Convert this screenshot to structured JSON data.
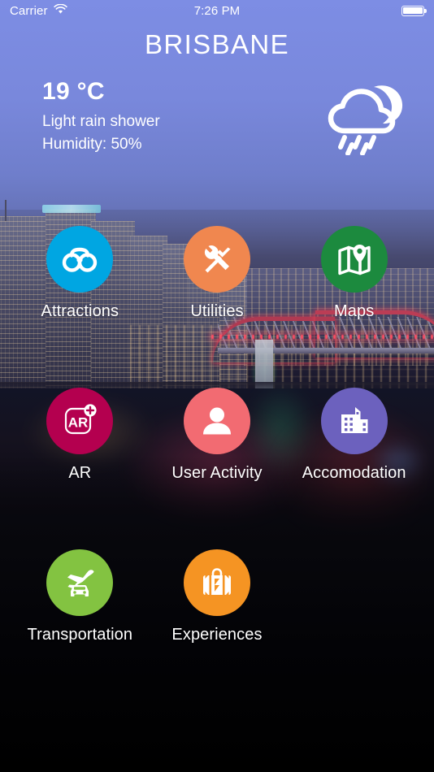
{
  "status_bar": {
    "carrier": "Carrier",
    "wifi_icon": "wifi-icon",
    "time": "7:26 PM",
    "battery_icon": "battery-full-icon"
  },
  "header": {
    "city_title": "BRISBANE",
    "background_description": "Brisbane city skyline at dusk with Story Bridge and river",
    "sky_color_top": "#7d8de4",
    "sky_color_bottom": "#5f6aa8"
  },
  "weather": {
    "temperature": "19 °C",
    "condition": "Light rain shower",
    "humidity": "Humidity: 50%",
    "icon": "night-rain-cloud-icon"
  },
  "apps": [
    {
      "label": "Attractions",
      "icon": "binoculars-icon",
      "color": "#00A6E2"
    },
    {
      "label": "Utilities",
      "icon": "tools-icon",
      "color": "#F0874F"
    },
    {
      "label": "Maps",
      "icon": "map-pin-icon",
      "color": "#1C8A3E"
    },
    {
      "label": "AR",
      "icon": "ar-plus-icon",
      "color": "#B4004F"
    },
    {
      "label": "User Activity",
      "icon": "person-icon",
      "color": "#F26B72"
    },
    {
      "label": "Accomodation",
      "icon": "building-icon",
      "color": "#6C61BE"
    },
    {
      "label": "Transportation",
      "icon": "plane-car-icon",
      "color": "#83C341"
    },
    {
      "label": "Experiences",
      "icon": "suitcase-icon",
      "color": "#F59423"
    }
  ]
}
